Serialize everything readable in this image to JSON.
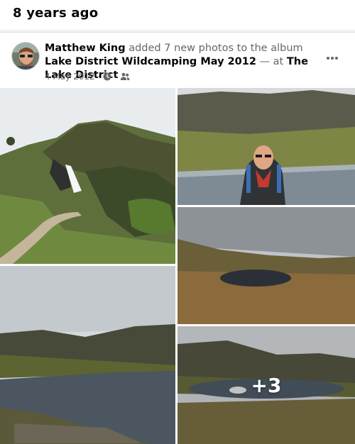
{
  "memory": {
    "title": "8 years ago"
  },
  "post": {
    "author": "Matthew King",
    "action": "added 7 new photos to the album",
    "album": "Lake District Wildcamping May 2012",
    "separator": "— at",
    "location": "The Lake District",
    "date": "4 May 2012",
    "dot": "·",
    "audience_icon": "friends-icon",
    "clock_icon": "clock-icon",
    "more_icon": "more-options-icon"
  },
  "photos": {
    "count": 5,
    "more_label": "+3"
  },
  "colors": {
    "muted_text": "#65676b",
    "divider": "#dddfe2"
  }
}
